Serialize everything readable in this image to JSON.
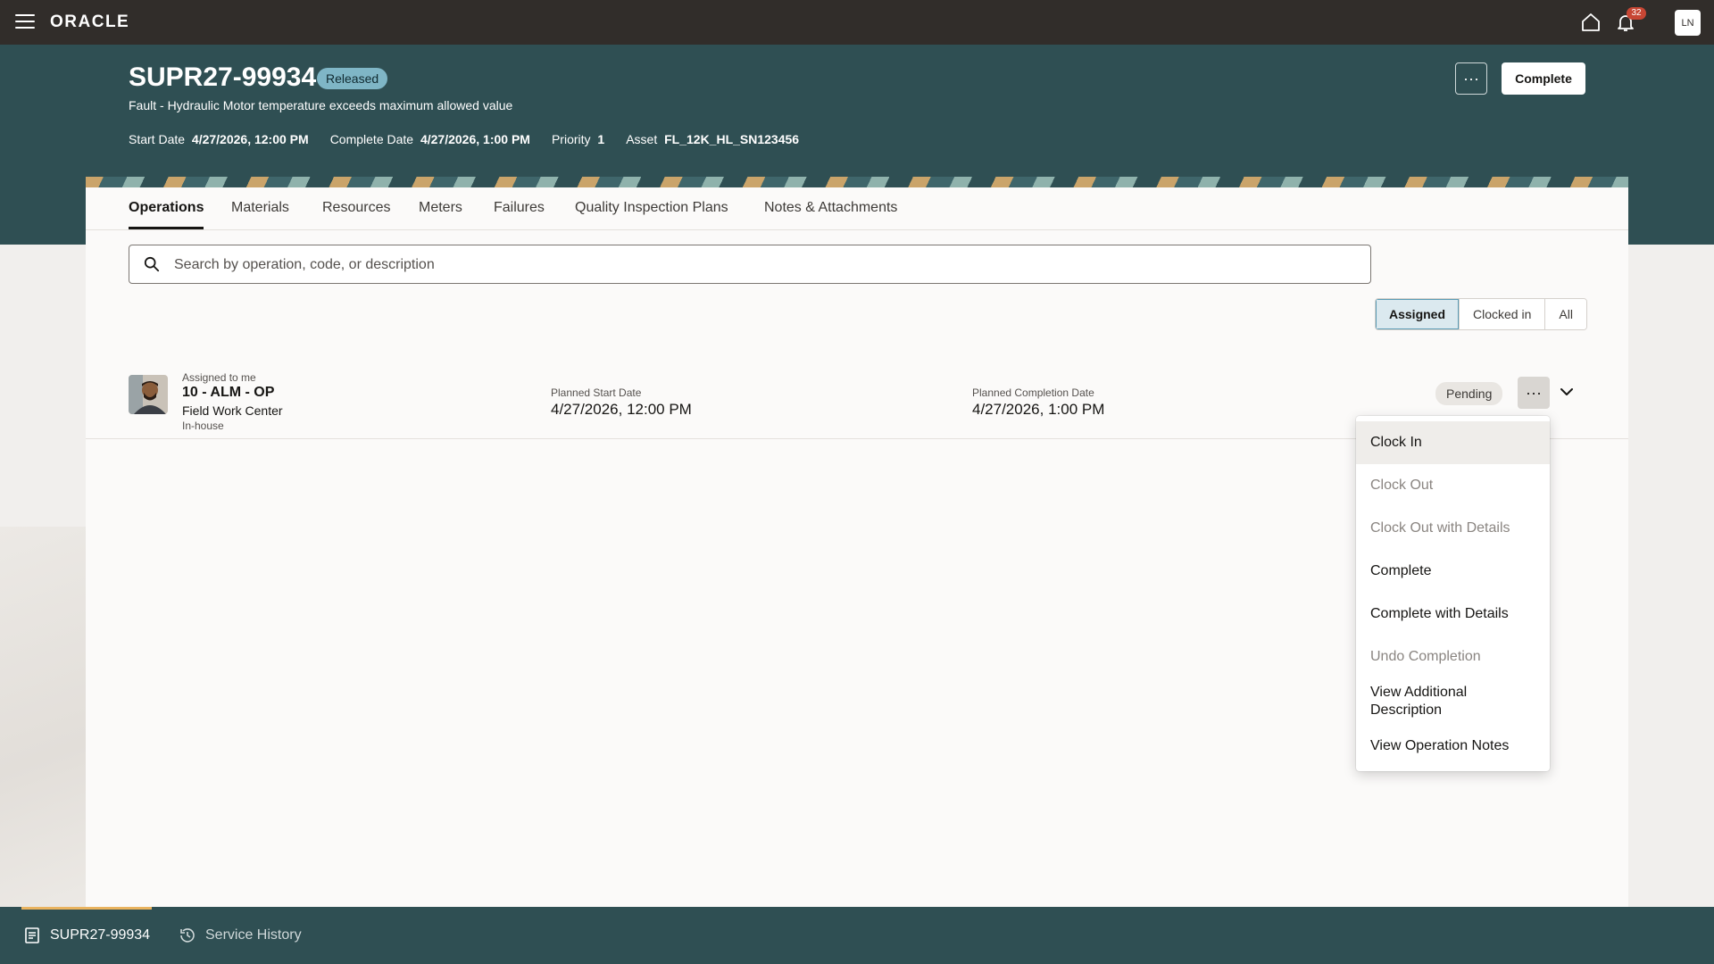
{
  "topbar": {
    "logo": "ORACLE",
    "notification_count": "32",
    "user_initials": "LN"
  },
  "header": {
    "work_order_id": "SUPR27-99934",
    "status": "Released",
    "description": "Fault - Hydraulic Motor temperature exceeds maximum allowed value",
    "meta": {
      "start_label": "Start Date",
      "start_value": "4/27/2026, 12:00 PM",
      "complete_label": "Complete Date",
      "complete_value": "4/27/2026, 1:00 PM",
      "priority_label": "Priority",
      "priority_value": "1",
      "asset_label": "Asset",
      "asset_value": "FL_12K_HL_SN123456"
    },
    "more_label": "···",
    "complete_button": "Complete"
  },
  "tabs": [
    {
      "label": "Operations",
      "active": true
    },
    {
      "label": "Materials"
    },
    {
      "label": "Resources"
    },
    {
      "label": "Meters"
    },
    {
      "label": "Failures"
    },
    {
      "label": "Quality Inspection Plans"
    },
    {
      "label": "Notes & Attachments"
    }
  ],
  "search": {
    "placeholder": "Search by operation, code, or description",
    "value": ""
  },
  "filters": {
    "options": [
      "Assigned",
      "Clocked in",
      "All"
    ],
    "selected": "Assigned"
  },
  "operation": {
    "assigned_text": "Assigned to me",
    "name": "10 - ALM - OP",
    "work_center": "Field Work Center",
    "type": "In-house",
    "planned_start_label": "Planned Start Date",
    "planned_start_value": "4/27/2026, 12:00 PM",
    "planned_completion_label": "Planned Completion Date",
    "planned_completion_value": "4/27/2026, 1:00 PM",
    "status": "Pending",
    "more_label": "···"
  },
  "action_menu": {
    "items": [
      {
        "label": "Clock In",
        "enabled": true,
        "hovered": true
      },
      {
        "label": "Clock Out",
        "enabled": false
      },
      {
        "label": "Clock Out with Details",
        "enabled": false
      },
      {
        "label": "Complete",
        "enabled": true
      },
      {
        "label": "Complete with Details",
        "enabled": true
      },
      {
        "label": "Undo Completion",
        "enabled": false
      },
      {
        "label": "View Additional Description",
        "enabled": true
      },
      {
        "label": "View Operation Notes",
        "enabled": true
      }
    ]
  },
  "bottom_nav": {
    "items": [
      {
        "label": "SUPR27-99934",
        "active": true,
        "icon": "document-icon"
      },
      {
        "label": "Service History",
        "active": false,
        "icon": "history-icon"
      }
    ]
  },
  "colors": {
    "topbar": "#312d2a",
    "header": "#2f4f53",
    "accent": "#e9b35f",
    "status_badge": "#7fb6c6"
  }
}
